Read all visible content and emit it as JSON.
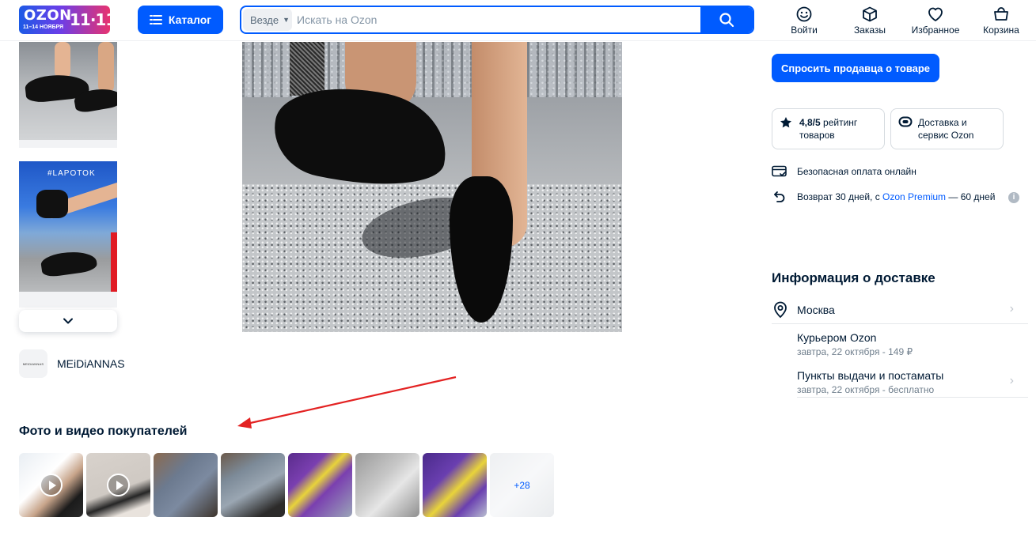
{
  "header": {
    "logo_text": "OZON",
    "logo_dates": "11–14 НОЯБРЯ",
    "logo_big": "11·11",
    "catalog_label": "Каталог",
    "search_scope": "Везде",
    "search_placeholder": "Искать на Ozon",
    "nav": [
      {
        "label": "Войти",
        "icon": "smile-icon"
      },
      {
        "label": "Заказы",
        "icon": "box-icon"
      },
      {
        "label": "Избранное",
        "icon": "heart-icon"
      },
      {
        "label": "Корзина",
        "icon": "basket-icon"
      }
    ],
    "accent_color": "#005bff"
  },
  "gallery": {
    "thumb2_tag": "#LAPOTOK"
  },
  "brand": {
    "logo_text": "MEiDiANNAS",
    "name": "MEiDiANNAS"
  },
  "reviews_media": {
    "title": "Фото и видео покупателей",
    "more_count": "+28"
  },
  "seller": {
    "ask_button": "Спросить продавца о товаре",
    "rating_value": "4,8/5",
    "rating_text": " рейтинг товаров",
    "delivery_card": "Доставка и сервис Ozon",
    "safe_payment": "Безопасная оплата онлайн",
    "return_prefix": "Возврат 30 дней, с ",
    "return_link": "Ozon Premium",
    "return_suffix": " — 60 дней",
    "info_mark": "i"
  },
  "delivery": {
    "title": "Информация о доставке",
    "city": "Москва",
    "options": [
      {
        "name": "Курьером Ozon",
        "details": "завтра, 22 октября - 149 ₽"
      },
      {
        "name": "Пункты выдачи и постаматы",
        "details": "завтра, 22 октября - бесплатно"
      }
    ]
  }
}
